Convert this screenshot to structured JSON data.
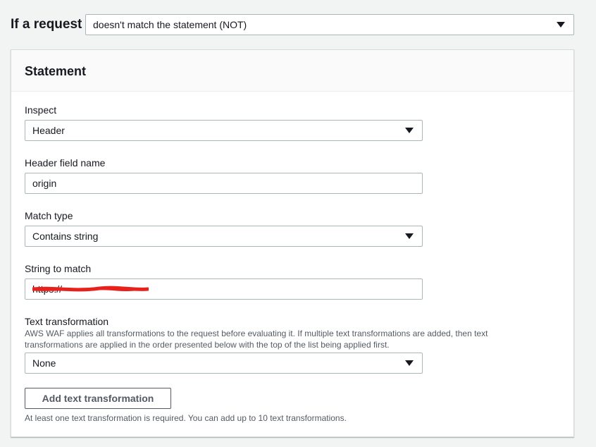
{
  "condition": {
    "label": "If a request",
    "selected": "doesn't match the statement (NOT)"
  },
  "statement": {
    "title": "Statement",
    "inspect": {
      "label": "Inspect",
      "selected": "Header"
    },
    "header_field_name": {
      "label": "Header field name",
      "value": "origin"
    },
    "match_type": {
      "label": "Match type",
      "selected": "Contains string"
    },
    "string_to_match": {
      "label": "String to match",
      "value": "https://",
      "redacted": true,
      "redaction_color": "#e8211d"
    },
    "text_transformation": {
      "label": "Text transformation",
      "description": "AWS WAF applies all transformations to the request before evaluating it. If multiple text transformations are added, then text transformations are applied in the order presented below with the top of the list being applied first.",
      "selected": "None",
      "add_button_label": "Add text transformation",
      "footnote": "At least one text transformation is required. You can add up to 10 text transformations."
    }
  },
  "icons": {
    "dropdown": "caret-down-icon"
  },
  "colors": {
    "page_background": "#f2f3f3",
    "panel_background": "#ffffff",
    "panel_header_background": "#fafafa",
    "border": "#aab7b8",
    "text": "#16191f",
    "secondary_text": "#545b64"
  }
}
